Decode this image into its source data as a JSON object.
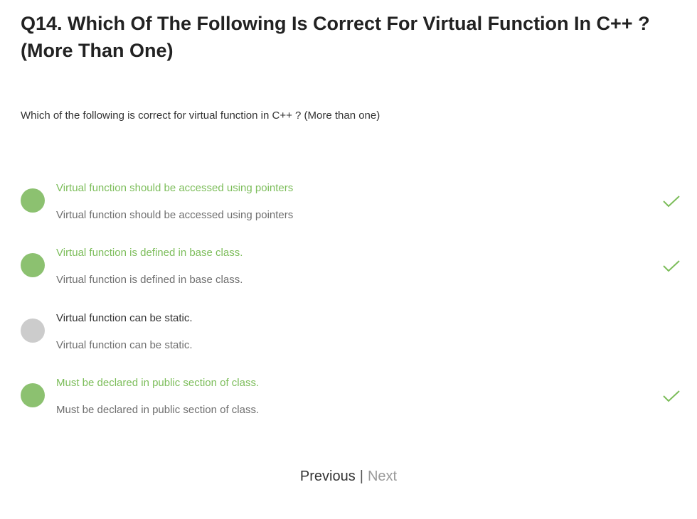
{
  "question": {
    "title": "Q14. Which Of The Following Is Correct For Virtual Function In C++ ? (More Than One)",
    "text": "Which of the following is correct for virtual function in C++ ? (More than one)"
  },
  "options": [
    {
      "label": "Virtual function should be accessed using pointers",
      "description": "Virtual function should be accessed using pointers",
      "correct": true
    },
    {
      "label": "Virtual function is defined in base class.",
      "description": "Virtual function is defined in base class.",
      "correct": true
    },
    {
      "label": "Virtual function can be static.",
      "description": "Virtual function can be static.",
      "correct": false
    },
    {
      "label": "Must be declared in public section of class.",
      "description": "Must be declared in public section of class.",
      "correct": true
    }
  ],
  "pager": {
    "previous_label": "Previous",
    "separator": "|",
    "next_label": "Next"
  },
  "colors": {
    "correct_green": "#8cc170",
    "correct_text_green": "#7cbd5a",
    "unselected_gray": "#cccccc",
    "next_disabled_gray": "#9a9a9a"
  },
  "icons": {
    "correct_marker": "checkmark-icon",
    "option_marker": "circle-indicator-icon"
  }
}
